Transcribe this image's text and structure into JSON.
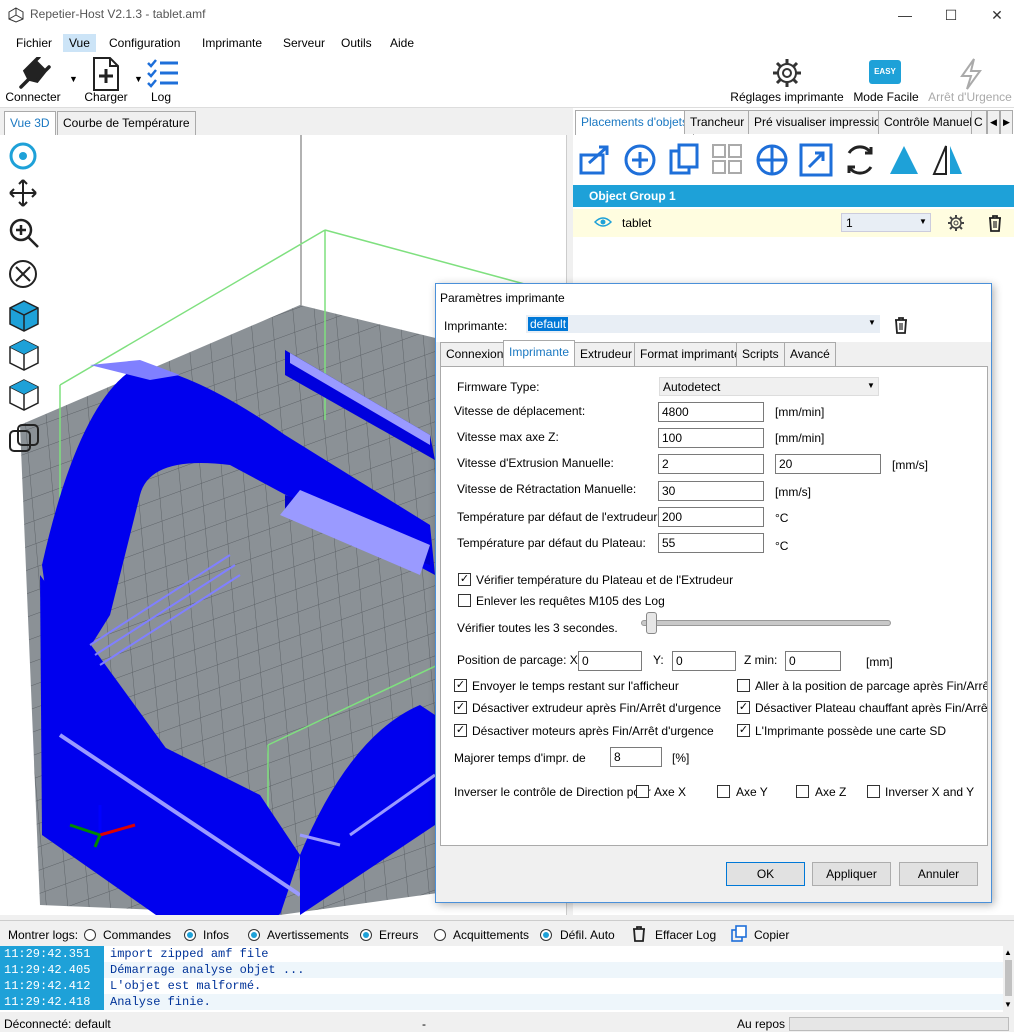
{
  "window": {
    "title": "Repetier-Host V2.1.3 - tablet.amf"
  },
  "menu": [
    "Fichier",
    "Vue",
    "Configuration",
    "Imprimante",
    "Serveur",
    "Outils",
    "Aide"
  ],
  "toolbar": {
    "connect": "Connecter",
    "load": "Charger",
    "log": "Log",
    "printer_settings": "Réglages imprimante",
    "easy_mode": "Mode Facile",
    "easy_badge": "EASY",
    "emergency": "Arrêt d'Urgence"
  },
  "left_tabs": [
    "Vue 3D",
    "Courbe de Température"
  ],
  "right_tabs": [
    "Placements d'objets",
    "Trancheur",
    "Pré visualiser impression",
    "Contrôle Manuel",
    "C"
  ],
  "objects": {
    "group": "Object Group 1",
    "name": "tablet",
    "count": "1"
  },
  "dialog": {
    "title": "Paramètres imprimante",
    "printer_label": "Imprimante:",
    "printer_value": "default",
    "tabs": [
      "Connexion",
      "Imprimante",
      "Extrudeur",
      "Format imprimante",
      "Scripts",
      "Avancé"
    ],
    "firmware_label": "Firmware Type:",
    "firmware_value": "Autodetect",
    "travel_label": "Vitesse de déplacement:",
    "travel_value": "4800",
    "travel_unit": "[mm/min]",
    "zmax_label": "Vitesse max axe Z:",
    "zmax_value": "100",
    "zmax_unit": "[mm/min]",
    "extr_label": "Vitesse d'Extrusion Manuelle:",
    "extr_value1": "2",
    "extr_value2": "20",
    "extr_unit": "[mm/s]",
    "retr_label": "Vitesse de Rétractation Manuelle:",
    "retr_value": "30",
    "retr_unit": "[mm/s]",
    "temp_ext_label": "Température par défaut de l'extrudeur:",
    "temp_ext_value": "200",
    "temp_ext_unit": "°C",
    "temp_bed_label": "Température par défaut du Plateau:",
    "temp_bed_value": "55",
    "temp_bed_unit": "°C",
    "check_temp": "Vérifier température du Plateau et de l'Extrudeur",
    "remove_m105": "Enlever les requêtes M105 des Log",
    "check_every": "Vérifier toutes les 3 secondes.",
    "park_label": "Position de parcage: X:",
    "park_x": "0",
    "park_y_label": "Y:",
    "park_y": "0",
    "park_z_label": "Z min:",
    "park_z": "0",
    "park_unit": "[mm]",
    "send_time": "Envoyer le temps restant sur l'afficheur",
    "goto_park": "Aller à la position de parcage après Fin/Arrêt d'urg",
    "disable_extruder": "Désactiver extrudeur après Fin/Arrêt d'urgence",
    "disable_bed": "Désactiver Plateau chauffant après Fin/Arrêt d'urg",
    "disable_motors": "Désactiver moteurs après Fin/Arrêt d'urgence",
    "has_sd": "L'Imprimante possède une carte SD",
    "increase_label": "Majorer temps d'impr. de",
    "increase_value": "8",
    "increase_unit": "[%]",
    "invert_label": "Inverser le contrôle de Direction pour",
    "axis_x": "Axe X",
    "axis_y": "Axe Y",
    "axis_z": "Axe Z",
    "invert_xy": "Inverser X and Y",
    "ok": "OK",
    "apply": "Appliquer",
    "cancel": "Annuler",
    "slider_value": 0.02
  },
  "logbar": {
    "show": "Montrer logs:",
    "commands": "Commandes",
    "infos": "Infos",
    "warnings": "Avertissements",
    "errors": "Erreurs",
    "acks": "Acquittements",
    "autoscroll": "Défil. Auto",
    "clear": "Effacer Log",
    "copy": "Copier"
  },
  "log": [
    {
      "time": "11:29:42.351",
      "msg": "import zipped amf file"
    },
    {
      "time": "11:29:42.405",
      "msg": "Démarrage analyse objet ..."
    },
    {
      "time": "11:29:42.412",
      "msg": "L'objet est malformé."
    },
    {
      "time": "11:29:42.418",
      "msg": "Analyse finie."
    }
  ],
  "status": {
    "connection": "Déconnecté: default",
    "dash": "-",
    "idle": "Au repos"
  },
  "colors": {
    "accent": "#1ea1d8",
    "model": "#0000ee",
    "grid": "#8a9196"
  }
}
